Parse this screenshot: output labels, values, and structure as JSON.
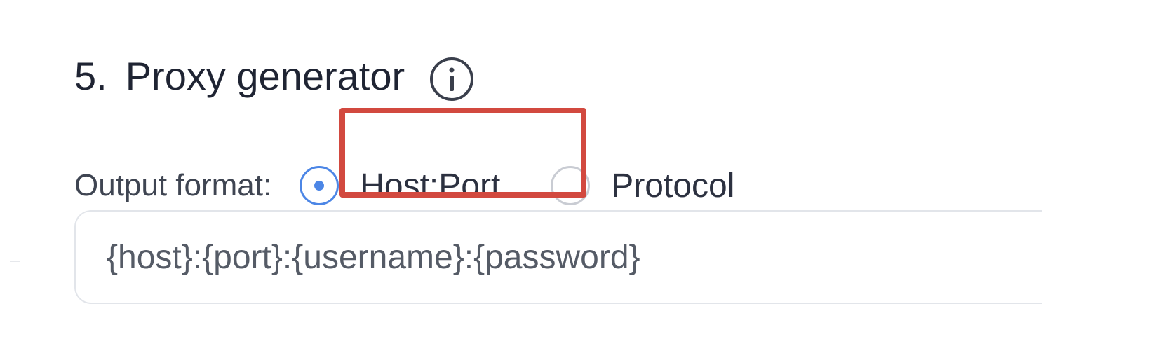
{
  "section": {
    "number": "5.",
    "title": "Proxy generator",
    "info_icon": "info-icon"
  },
  "output_format": {
    "label": "Output format:",
    "options": [
      {
        "label": "Host:Port",
        "selected": true
      },
      {
        "label": "Protocol",
        "selected": false
      }
    ]
  },
  "format_field": {
    "value": "{host}:{port}:{username}:{password}"
  },
  "colors": {
    "accent": "#4c86e6",
    "highlight": "#d2493f"
  }
}
